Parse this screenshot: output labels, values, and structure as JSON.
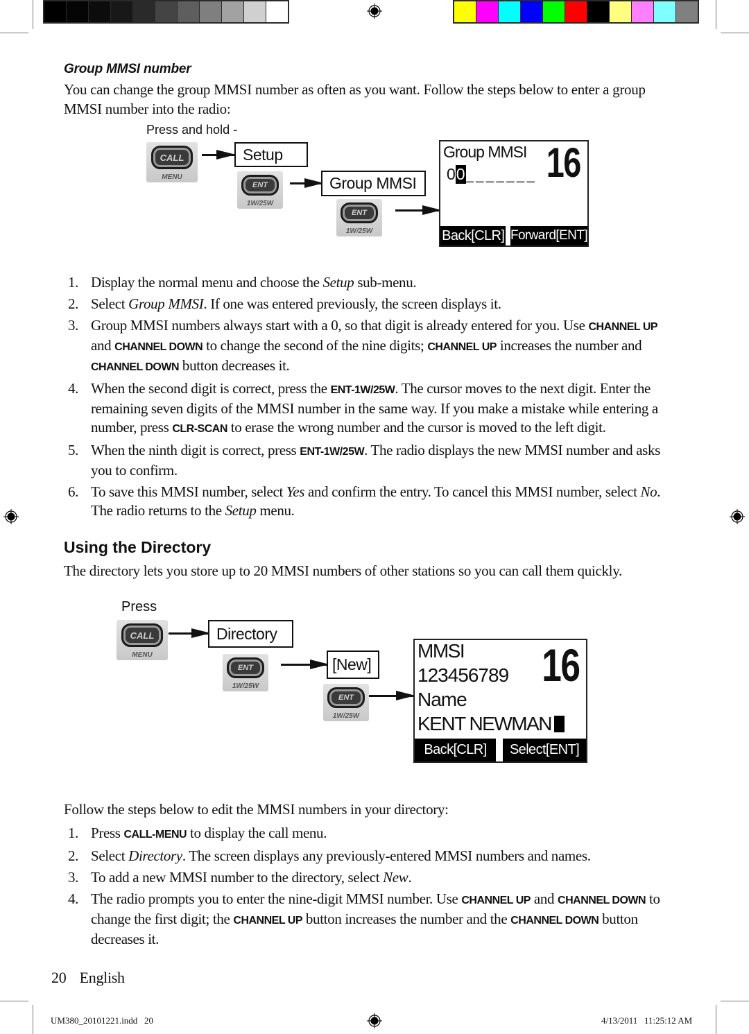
{
  "print_marks": {
    "grayscale_bar": [
      "#000000",
      "#050505",
      "#0c0c0c",
      "#181818",
      "#2a2a2a",
      "#444444",
      "#5e5e5e",
      "#7f7f7f",
      "#a2a2a2",
      "#d0d0d0",
      "#ffffff"
    ],
    "color_bar": [
      "#ffff00",
      "#ff00ff",
      "#00ffff",
      "#0000ff",
      "#00ff00",
      "#ff0000",
      "#000000",
      "#ffff80",
      "#ff80ff",
      "#80ffff",
      "#808080"
    ]
  },
  "group_mmsi": {
    "subheading": "Group MMSI number",
    "intro": "You can change the group MMSI number as often as you want. Follow the steps below to enter a group MMSI number into the radio:",
    "diagram": {
      "instruction": "Press and hold -",
      "call_button": {
        "label": "CALL",
        "sub": "MENU"
      },
      "ent_button": {
        "label": "ENT",
        "sub": "1W/25W"
      },
      "menu_1": "Setup",
      "menu_2": "Group MMSI",
      "lcd": {
        "title": "Group MMSI",
        "channel": "16",
        "entry_prefix": "0",
        "cursor_digit": "0",
        "placeholder": "_ _ _ _ _ _ _",
        "soft_left": "Back[CLR]",
        "soft_right": "Forward[ENT]"
      }
    },
    "steps": [
      {
        "num": "1.",
        "parts": [
          [
            "t",
            "Display the normal menu and choose the "
          ],
          [
            "i",
            "Setup"
          ],
          [
            "t",
            " sub-menu."
          ]
        ]
      },
      {
        "num": "2.",
        "parts": [
          [
            "t",
            "Select "
          ],
          [
            "i",
            "Group MMSI"
          ],
          [
            "t",
            ". If one was entered previously, the screen displays it."
          ]
        ]
      },
      {
        "num": "3.",
        "parts": [
          [
            "t",
            "Group MMSI numbers always start with a 0, so that digit is already entered for you. Use "
          ],
          [
            "k",
            "CHANNEL UP"
          ],
          [
            "t",
            " and "
          ],
          [
            "k",
            "CHANNEL DOWN"
          ],
          [
            "t",
            " to change the second of the nine digits; "
          ],
          [
            "k",
            "CHANNEL UP"
          ],
          [
            "t",
            " increases the number and "
          ],
          [
            "k",
            "CHANNEL DOWN"
          ],
          [
            "t",
            " button decreases it."
          ]
        ]
      },
      {
        "num": "4.",
        "parts": [
          [
            "t",
            "When the second digit is correct, press the "
          ],
          [
            "k",
            "ENT-1W/25W"
          ],
          [
            "t",
            ". The cursor moves to the next digit. Enter the remaining seven digits of the MMSI number in the same way.  If you make a mistake while entering a number, press "
          ],
          [
            "k",
            "CLR-SCAN"
          ],
          [
            "t",
            " to erase the wrong number and the cursor is moved to the left digit."
          ]
        ]
      },
      {
        "num": "5.",
        "parts": [
          [
            "t",
            "When the ninth digit is correct, press "
          ],
          [
            "k",
            "ENT-1W/25W"
          ],
          [
            "t",
            ". The radio displays the new MMSI number and asks you to confirm."
          ]
        ]
      },
      {
        "num": "6.",
        "parts": [
          [
            "t",
            "To save this MMSI number, select "
          ],
          [
            "i",
            "Yes"
          ],
          [
            "t",
            " and confirm the entry. To cancel this MMSI number, select "
          ],
          [
            "i",
            "No"
          ],
          [
            "t",
            ". The radio returns to the "
          ],
          [
            "i",
            "Setup"
          ],
          [
            "t",
            " menu."
          ]
        ]
      }
    ]
  },
  "directory": {
    "title": "Using the Directory",
    "intro": "The directory lets you store up to 20 MMSI numbers of other stations so you can call them quickly.",
    "diagram": {
      "instruction": "Press",
      "call_button": {
        "label": "CALL",
        "sub": "MENU"
      },
      "ent_button": {
        "label": "ENT",
        "sub": "1W/25W"
      },
      "menu_1": "Directory",
      "menu_2": "[New]",
      "lcd": {
        "line1": "MMSI",
        "line2": "123456789",
        "line3": "Name",
        "line4": "KENT NEWMAN",
        "channel": "16",
        "soft_left": "Back[CLR]",
        "soft_right": "Select[ENT]"
      }
    },
    "follow": "Follow the steps below to edit the MMSI numbers in your directory:",
    "steps": [
      {
        "num": "1.",
        "parts": [
          [
            "t",
            "Press "
          ],
          [
            "k",
            "CALL-MENU"
          ],
          [
            "t",
            " to display the call menu."
          ]
        ]
      },
      {
        "num": "2.",
        "parts": [
          [
            "t",
            "Select "
          ],
          [
            "i",
            "Directory"
          ],
          [
            "t",
            ". The screen displays any previously-entered MMSI numbers and names."
          ]
        ]
      },
      {
        "num": "3.",
        "parts": [
          [
            "t",
            "To add a new MMSI number to the directory, select "
          ],
          [
            "i",
            "New"
          ],
          [
            "t",
            "."
          ]
        ]
      },
      {
        "num": "4.",
        "parts": [
          [
            "t",
            "The radio prompts you to enter the nine-digit MMSI number. Use "
          ],
          [
            "k",
            "CHANNEL UP"
          ],
          [
            "t",
            " and "
          ],
          [
            "k",
            "CHANNEL DOWN"
          ],
          [
            "t",
            "  to change the first digit; the "
          ],
          [
            "k",
            "CHANNEL UP"
          ],
          [
            "t",
            " button increases the number and the "
          ],
          [
            "k",
            "CHANNEL DOWN"
          ],
          [
            "t",
            " button decreases it."
          ]
        ]
      }
    ]
  },
  "page_footer": {
    "page_number": "20",
    "language": "English"
  },
  "slug": {
    "file": "UM380_20101221.indd   20",
    "timestamp": "4/13/2011   11:25:12 AM"
  }
}
